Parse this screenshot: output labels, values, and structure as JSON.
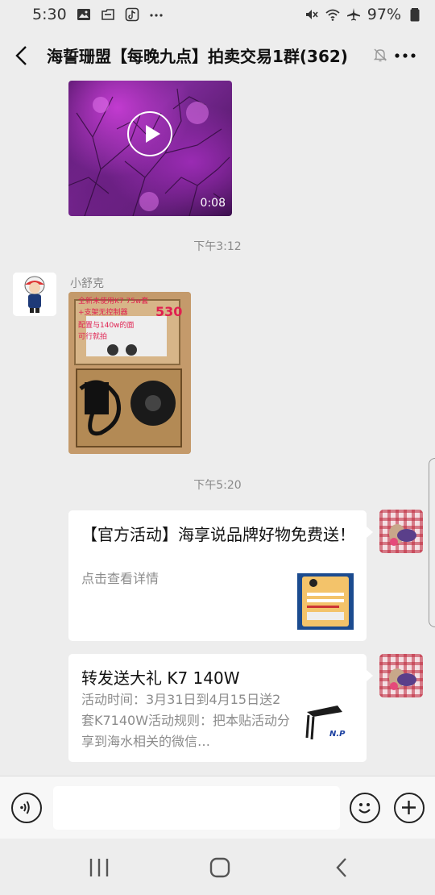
{
  "status_bar": {
    "time": "5:30",
    "battery": "97%"
  },
  "header": {
    "title": "海誓珊盟【每晚九点】拍卖交易1群(362)"
  },
  "messages": {
    "video": {
      "duration": "0:08"
    },
    "timestamp_1": "下午3:12",
    "photo_message": {
      "sender": "小舒克",
      "overlay_lines": [
        "全新未使用K7 75w套",
        "+支架无控制器",
        "530",
        "配置与140w的面",
        "可行就拍"
      ]
    },
    "timestamp_2": "下午5:20",
    "card_1": {
      "title": "【官方活动】海享说品牌好物免费送！",
      "desc": "点击查看详情"
    },
    "card_2": {
      "title": "转发送大礼 K7 140W",
      "desc": "活动时间：3月31日到4月15日送2套K7140W活动规则：把本贴活动分享到海水相关的微信…",
      "thumb_logo": "N.P"
    }
  },
  "input": {
    "placeholder": ""
  },
  "colors": {
    "background": "#ededed",
    "bubble": "#ffffff",
    "muted_text": "#8c8c8c"
  },
  "icons": [
    "gallery-icon",
    "folder-icon",
    "tiktok-icon",
    "more-dots-icon",
    "mute-vibrate-icon",
    "wifi-icon",
    "airplane-icon",
    "battery-icon",
    "back-icon",
    "mute-bell-icon",
    "more-icon",
    "play-icon",
    "voice-icon",
    "emoji-icon",
    "plus-icon",
    "recent-apps-icon",
    "home-icon",
    "nav-back-icon"
  ]
}
